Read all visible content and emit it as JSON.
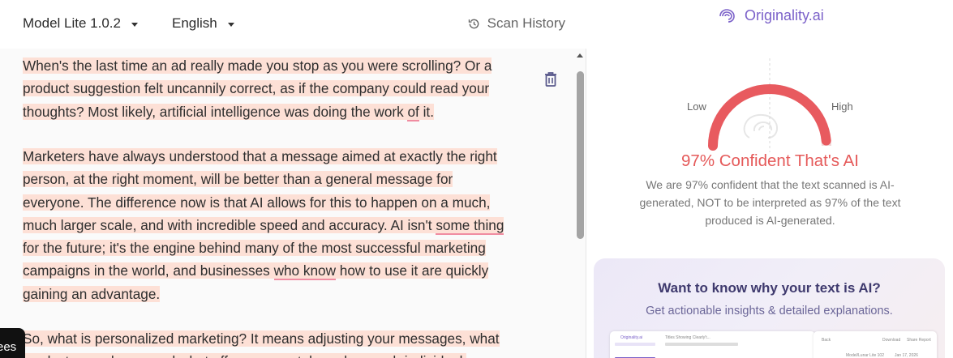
{
  "toolbar": {
    "model_label": "Model Lite 1.0.2",
    "language_label": "English",
    "scan_history_label": "Scan History"
  },
  "document": {
    "p1_a": "When's the last time an ad really made you stop as you were scrolling? Or a product suggestion felt uncannily correct, as if the company could read your thoughts? Most likely, artificial intelligence was doing the work ",
    "p1_u": "of",
    "p1_b": " it.",
    "p2_a": "Marketers have always understood that a message aimed at exactly the right person, at the right moment, will be better than a general message for everyone. The difference now is that AI allows for this to happen on a much, much larger scale, and with incredible speed and accuracy. AI isn't ",
    "p2_u1": "some thing",
    "p2_b": " for the future; it's the engine behind many of the most successful marketing campaigns in the world, and businesses ",
    "p2_u2": "who know",
    "p2_c": " how to use it are quickly gaining an advantage.",
    "p3_a": "So, what is personalized marketing? It means adjusting your messages, what products are shown, and what offers are sent, based on each individual."
  },
  "overlay": {
    "partial_label": "ees"
  },
  "result": {
    "brand": "Originality.ai",
    "low_label": "Low",
    "high_label": "High",
    "confidence_percent": 97,
    "title": "97% Confident That's AI",
    "description": "We are 97% confident that the text scanned is AI-generated, NOT to be interpreted as 97% of the text produced is AI-generated."
  },
  "promo": {
    "heading": "Want to know why your text is AI?",
    "subheading": "Get actionable insights & detailed explanations.",
    "preview_brand": "Originality.ai",
    "preview_title": "Titles Showing Clearly't...",
    "preview_back": "Back",
    "preview_download": "Download",
    "preview_share": "Share Report",
    "preview_model": "Model/Lunar Lite 102",
    "preview_date": "Jan 17, 2026"
  },
  "colors": {
    "gauge_red": "#e85a5f",
    "highlight": "#fde0d6",
    "underline": "#f08ca1",
    "brand_purple": "#7b61c9"
  }
}
